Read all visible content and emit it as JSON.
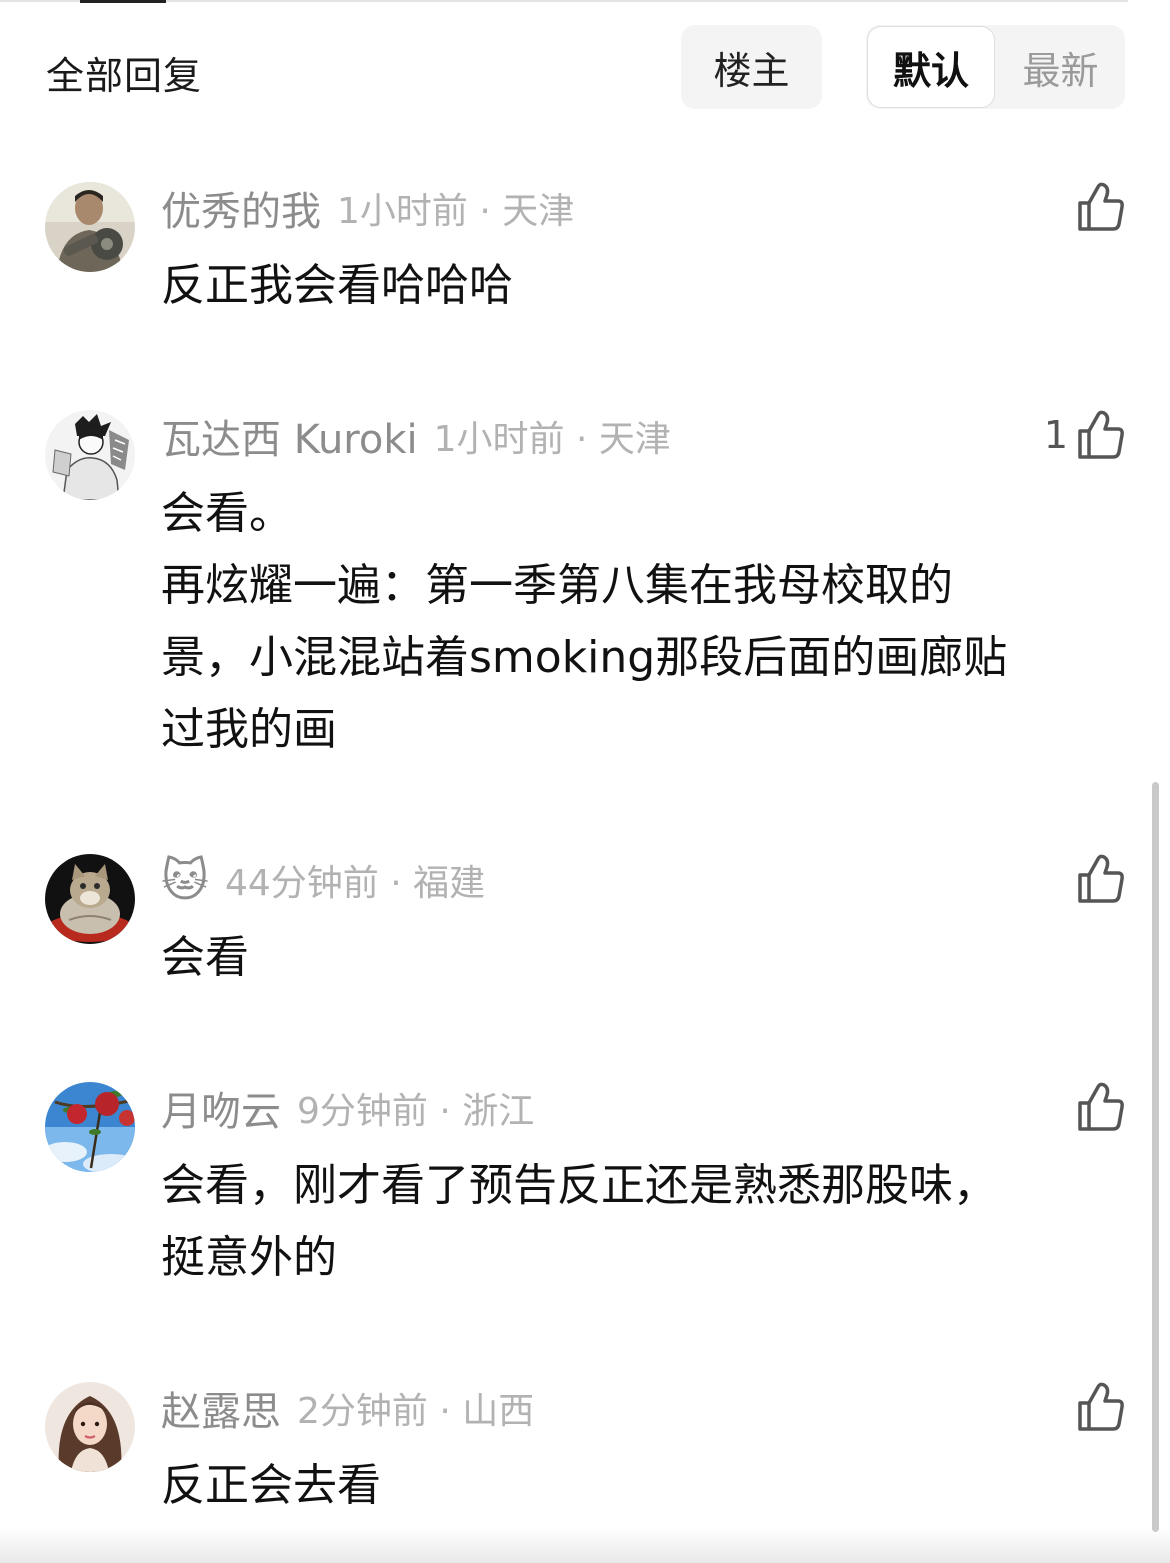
{
  "header": {
    "title": "全部回复",
    "filter_op": "楼主",
    "sort_default": "默认",
    "sort_newest": "最新"
  },
  "comments": [
    {
      "username": "优秀的我",
      "time_location": "1小时前 · 天津",
      "content": "反正我会看哈哈哈",
      "likes": ""
    },
    {
      "username": "瓦达西 Kuroki",
      "time_location": "1小时前 · 天津",
      "content_lines": [
        "会看。",
        "再炫耀一遍：第一季第八集在我母校取的",
        "景，小混混站着smoking那段后面的画廊贴",
        "过我的画"
      ],
      "likes": "1"
    },
    {
      "username": "🐱",
      "time_location": "44分钟前 · 福建",
      "content": "会看",
      "likes": ""
    },
    {
      "username": "月吻云",
      "time_location": "9分钟前 · 浙江",
      "content_lines": [
        "会看，刚才看了预告反正还是熟悉那股味，",
        "挺意外的"
      ],
      "likes": ""
    },
    {
      "username": "赵露思",
      "time_location": "2分钟前 · 山西",
      "content": "反正会去看",
      "likes": ""
    }
  ],
  "icons": {
    "like": "thumbs-up-icon"
  },
  "colors": {
    "username": "#8c8c8c",
    "meta": "#b2b2b2",
    "text": "#111111",
    "chip_bg": "#f4f4f4"
  }
}
